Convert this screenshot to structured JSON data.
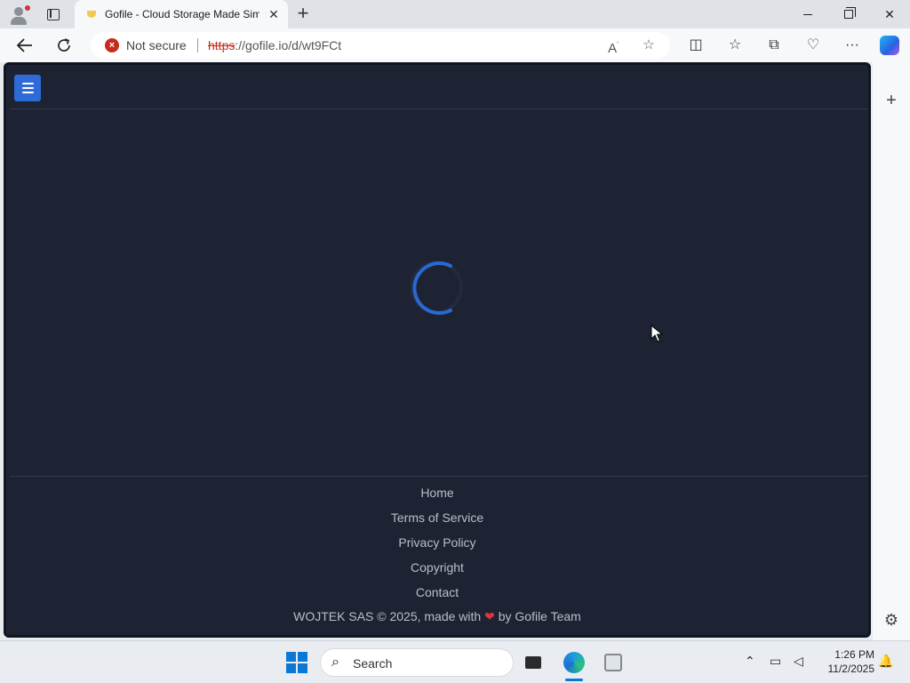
{
  "browser": {
    "tab_title": "Gofile - Cloud Storage Made Sim",
    "security_label": "Not secure",
    "url_scheme": "https",
    "url_rest": "://gofile.io/d/wt9FCt"
  },
  "page": {
    "footer_links": [
      "Home",
      "Terms of Service",
      "Privacy Policy",
      "Copyright",
      "Contact"
    ],
    "copyright_prefix": "WOJTEK SAS © 2025, made with",
    "copyright_suffix": "by Gofile Team",
    "accent_color": "#2e6ad8",
    "background_color": "#1d2333"
  },
  "taskbar": {
    "search_placeholder": "Search",
    "time": "1:26 PM",
    "date": "11/2/2025"
  }
}
